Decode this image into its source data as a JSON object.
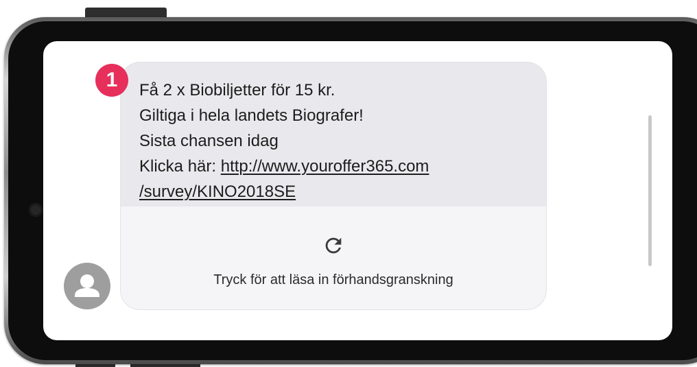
{
  "badge": {
    "number": "1",
    "color": "#e72f5b"
  },
  "message": {
    "lines": [
      "Få 2 x Biobiljetter för 15 kr.",
      "Giltiga i hela landets Biografer!",
      "Sista chansen idag"
    ],
    "link_prefix": "Klicka här: ",
    "link_line1": "http://www.youroffer365.com",
    "link_line2": "/survey/KINO2018SE"
  },
  "preview": {
    "icon": "reload-icon",
    "label": "Tryck för att läsa in förhandsgranskning"
  },
  "avatar": {
    "icon": "person-icon"
  },
  "colors": {
    "bubble": "#e9e9ed",
    "preview_panel": "#f5f4f7",
    "avatar": "#9e9e9e"
  }
}
